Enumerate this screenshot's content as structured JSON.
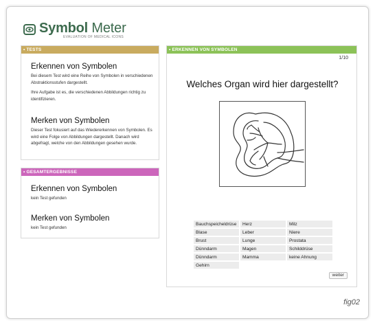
{
  "logo": {
    "title_bold": "Symbol",
    "title_rest": " Meter",
    "subtitle": "EVALUATION OF MEDICAL ICONS",
    "icon": "eye-icon",
    "color": "#3d6b4e"
  },
  "tests": {
    "header": "• TESTS",
    "color": "#c9ab5f",
    "section1": {
      "title": "Erkennen von Symbolen",
      "text1": "Bei diesem Test wird eine Reihe von Symbolen in verschiedenen Abstraktionsstufen dargestellt.",
      "text2": "Ihre Aufgabe ist es, die verschiedenen Abbildungen richtig zu identifizieren."
    },
    "section2": {
      "title": "Merken von Symbolen",
      "text": "Dieser Test fokusiert auf das Wiedererkennen von Symbolen. Es wird eine Folge von Abbildungen dargestellt. Danach wird abgefragt, welche von den Abbildungen gesehen wurde."
    }
  },
  "results": {
    "header": "• GESAMTERGEBNISSE",
    "color": "#cc66bb",
    "section1": {
      "title": "Erkennen von Symbolen",
      "text": "kein Test gefunden"
    },
    "section2": {
      "title": "Merken von Symbolen",
      "text": "kein Test gefunden"
    }
  },
  "quiz": {
    "header": "• ERKENNEN VON SYMBOLEN",
    "color": "#8cc258",
    "counter": "1/10",
    "question": "Welches Organ wird hier dargestellt?",
    "image_icon": "kidney-icon",
    "answers": [
      "Bauchspeicheldrüse",
      "Herz",
      "Milz",
      "Blase",
      "Leber",
      "Niere",
      "Brust",
      "Lunge",
      "Prostata",
      "Dünndarm",
      "Magen",
      "Schilddrüse",
      "Dünndarm",
      "Mamma",
      "keine Ahnung",
      "Gehirn"
    ],
    "next_label": "weiter"
  },
  "figure_label": "fig02"
}
